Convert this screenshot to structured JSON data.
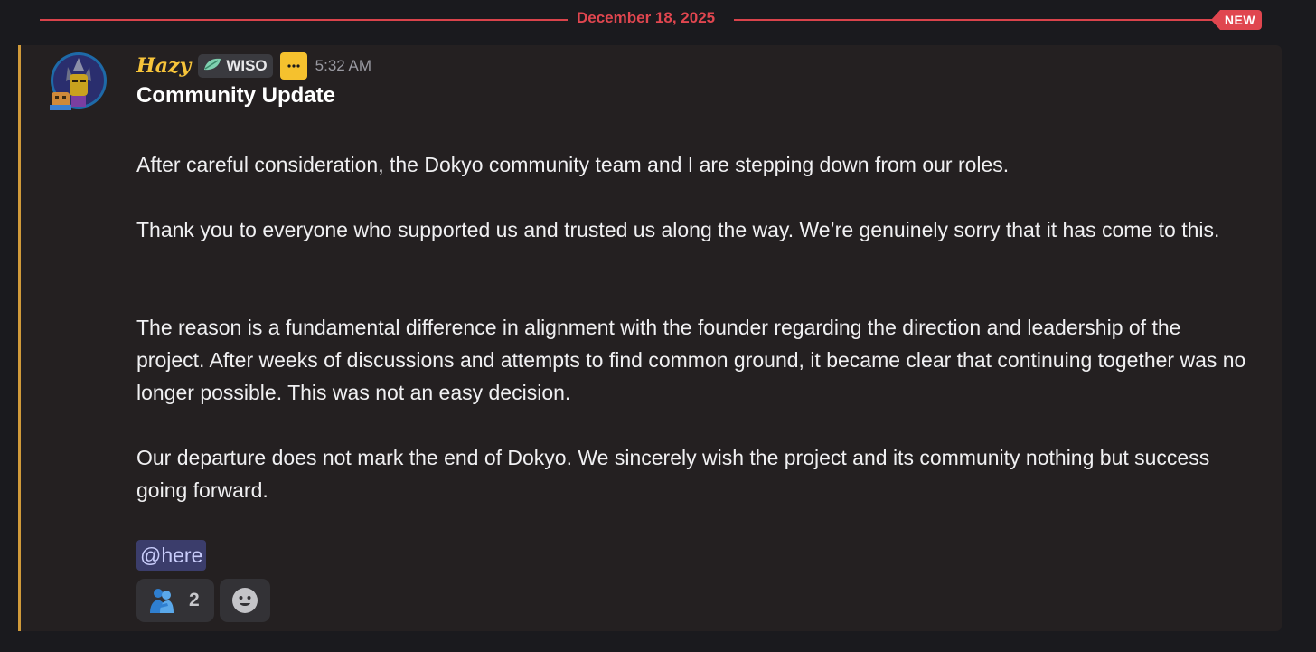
{
  "divider": {
    "date": "December 18, 2025",
    "new_label": "NEW"
  },
  "message": {
    "author": "Hazy",
    "tag": {
      "icon": "leaf-icon",
      "label": "WISO"
    },
    "app_badge_icon": "more-dots-icon",
    "timestamp": "5:32 AM",
    "title": "Community Update",
    "paragraphs": [
      "After careful consideration, the Dokyo community team and I are stepping down from our roles.",
      "Thank you to everyone who supported us and trusted us along the way. We’re genuinely sorry that it has come to this.",
      "The reason is a fundamental difference in alignment with the founder regarding the direction and leadership of the project. After weeks of discussions and attempts to find common ground, it became clear that continuing together was no longer possible. This was not an easy decision.",
      "Our departure does not mark the end of Dokyo. We sincerely wish the project and its community nothing but success going forward."
    ],
    "mention": "@here",
    "reactions": [
      {
        "icon": "people-hugging-icon",
        "count": "2"
      }
    ],
    "add_reaction_icon": "smiley-icon"
  },
  "colors": {
    "background": "#1a1a1e",
    "message_background": "#242021",
    "accent_border": "#d09a3a",
    "divider_red": "#e0464f",
    "username": "#f7c43a",
    "mention_bg": "#3b3d6b",
    "mention_text": "#c9cdfb"
  }
}
